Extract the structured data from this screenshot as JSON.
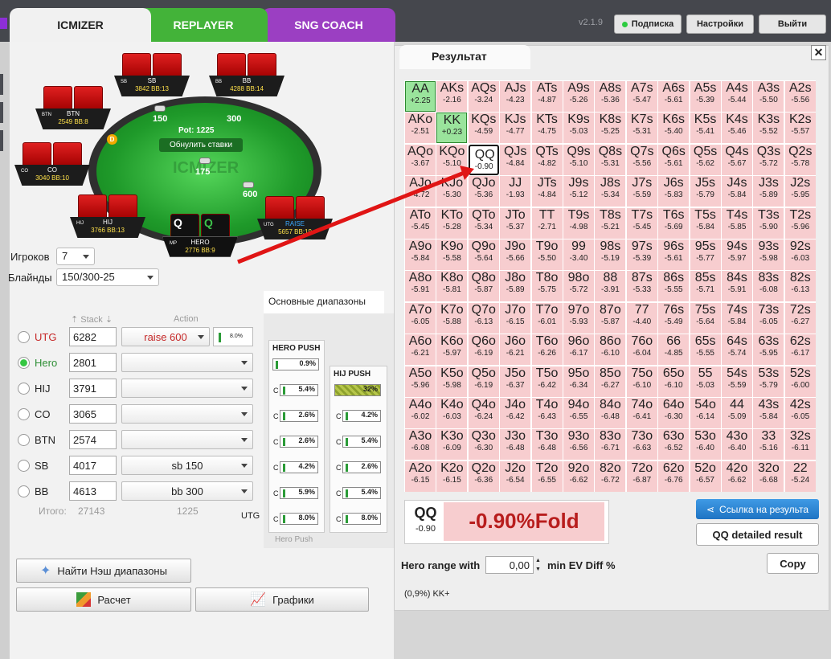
{
  "tabs": {
    "icmizer": "ICMIZER",
    "replayer": "REPLAYER",
    "sng_coach": "SNG COACH"
  },
  "version": "v2.1.9",
  "top_buttons": {
    "subscription": "Подписка",
    "settings": "Настройки",
    "exit": "Выйти"
  },
  "table": {
    "watermark": "ICMIZER",
    "pot": "Pot: 1225",
    "reset": "Обнулить ставки",
    "bets": {
      "sb": "150",
      "bb": "300",
      "hero": "175",
      "utg": "600"
    },
    "dealer": "D",
    "seats": [
      {
        "pos": "SB",
        "name": "SB",
        "info": "3842 BB:13"
      },
      {
        "pos": "BB",
        "name": "BB",
        "info": "4288 BB:14"
      },
      {
        "pos": "BTN",
        "name": "BTN",
        "info": "2549 BB:8"
      },
      {
        "pos": "CO",
        "name": "CO",
        "info": "3040 BB:10"
      },
      {
        "pos": "HIJ",
        "name": "HIJ",
        "info": "3766 BB:13"
      },
      {
        "pos": "UTG",
        "name": "RAISE",
        "info": "5657 BB:19"
      },
      {
        "pos": "MP",
        "name": "HERO",
        "info": "2776 BB:9"
      }
    ],
    "hero_cards": [
      "Q",
      "Q"
    ]
  },
  "settings": {
    "players_label": "Игроков",
    "players_value": "7",
    "blinds_label": "Блайнды",
    "blinds_value": "150/300-25"
  },
  "columns": {
    "stack": "Stack",
    "action": "Action"
  },
  "players": [
    {
      "name": "UTG",
      "stack": "6282",
      "action": "raise 600",
      "mini": "8.0%",
      "selected": false
    },
    {
      "name": "Hero",
      "stack": "2801",
      "action": "",
      "selected": true
    },
    {
      "name": "HIJ",
      "stack": "3791",
      "action": ""
    },
    {
      "name": "CO",
      "stack": "3065",
      "action": ""
    },
    {
      "name": "BTN",
      "stack": "2574",
      "action": ""
    },
    {
      "name": "SB",
      "stack": "4017",
      "action": "sb 150"
    },
    {
      "name": "BB",
      "stack": "4613",
      "action": "bb 300"
    }
  ],
  "totals": {
    "label": "Итого:",
    "stack": "27143",
    "pot": "1225",
    "utg": "UTG"
  },
  "ranges": {
    "tab": "Основные диапазоны",
    "hero_push": {
      "title": "HERO PUSH",
      "top": "0.9%",
      "values": [
        "5.4%",
        "2.6%",
        "2.6%",
        "4.2%",
        "5.9%",
        "8.0%"
      ],
      "footer": "Hero Push"
    },
    "hij_push": {
      "title": "HIJ PUSH",
      "top": "32%",
      "values": [
        "4.2%",
        "5.4%",
        "2.6%",
        "5.4%",
        "8.0%"
      ]
    },
    "c": "C"
  },
  "buttons": {
    "nash": "Найти Нэш диапазоны",
    "calc": "Расчет",
    "graphs": "Графики"
  },
  "result": {
    "title": "Результат",
    "close": "✕",
    "grid": [
      [
        [
          "AA",
          "+2.25"
        ],
        [
          "AKs",
          "-2.16"
        ],
        [
          "AQs",
          "-3.24"
        ],
        [
          "AJs",
          "-4.23"
        ],
        [
          "ATs",
          "-4.87"
        ],
        [
          "A9s",
          "-5.26"
        ],
        [
          "A8s",
          "-5.36"
        ],
        [
          "A7s",
          "-5.47"
        ],
        [
          "A6s",
          "-5.61"
        ],
        [
          "A5s",
          "-5.39"
        ],
        [
          "A4s",
          "-5.44"
        ],
        [
          "A3s",
          "-5.50"
        ],
        [
          "A2s",
          "-5.56"
        ]
      ],
      [
        [
          "AKo",
          "-2.51"
        ],
        [
          "KK",
          "+0.23"
        ],
        [
          "KQs",
          "-4.59"
        ],
        [
          "KJs",
          "-4.77"
        ],
        [
          "KTs",
          "-4.75"
        ],
        [
          "K9s",
          "-5.03"
        ],
        [
          "K8s",
          "-5.25"
        ],
        [
          "K7s",
          "-5.31"
        ],
        [
          "K6s",
          "-5.40"
        ],
        [
          "K5s",
          "-5.41"
        ],
        [
          "K4s",
          "-5.46"
        ],
        [
          "K3s",
          "-5.52"
        ],
        [
          "K2s",
          "-5.57"
        ]
      ],
      [
        [
          "AQo",
          "-3.67"
        ],
        [
          "KQo",
          "-5.10"
        ],
        [
          "QQ",
          "-0.90"
        ],
        [
          "QJs",
          "-4.84"
        ],
        [
          "QTs",
          "-4.82"
        ],
        [
          "Q9s",
          "-5.10"
        ],
        [
          "Q8s",
          "-5.31"
        ],
        [
          "Q7s",
          "-5.56"
        ],
        [
          "Q6s",
          "-5.61"
        ],
        [
          "Q5s",
          "-5.62"
        ],
        [
          "Q4s",
          "-5.67"
        ],
        [
          "Q3s",
          "-5.72"
        ],
        [
          "Q2s",
          "-5.78"
        ]
      ],
      [
        [
          "AJo",
          "-4.72"
        ],
        [
          "KJo",
          "-5.30"
        ],
        [
          "QJo",
          "-5.36"
        ],
        [
          "JJ",
          "-1.93"
        ],
        [
          "JTs",
          "-4.84"
        ],
        [
          "J9s",
          "-5.12"
        ],
        [
          "J8s",
          "-5.34"
        ],
        [
          "J7s",
          "-5.59"
        ],
        [
          "J6s",
          "-5.83"
        ],
        [
          "J5s",
          "-5.79"
        ],
        [
          "J4s",
          "-5.84"
        ],
        [
          "J3s",
          "-5.89"
        ],
        [
          "J2s",
          "-5.95"
        ]
      ],
      [
        [
          "ATo",
          "-5.45"
        ],
        [
          "KTo",
          "-5.28"
        ],
        [
          "QTo",
          "-5.34"
        ],
        [
          "JTo",
          "-5.37"
        ],
        [
          "TT",
          "-2.71"
        ],
        [
          "T9s",
          "-4.98"
        ],
        [
          "T8s",
          "-5.21"
        ],
        [
          "T7s",
          "-5.45"
        ],
        [
          "T6s",
          "-5.69"
        ],
        [
          "T5s",
          "-5.84"
        ],
        [
          "T4s",
          "-5.85"
        ],
        [
          "T3s",
          "-5.90"
        ],
        [
          "T2s",
          "-5.96"
        ]
      ],
      [
        [
          "A9o",
          "-5.84"
        ],
        [
          "K9o",
          "-5.58"
        ],
        [
          "Q9o",
          "-5.64"
        ],
        [
          "J9o",
          "-5.66"
        ],
        [
          "T9o",
          "-5.50"
        ],
        [
          "99",
          "-3.40"
        ],
        [
          "98s",
          "-5.19"
        ],
        [
          "97s",
          "-5.39"
        ],
        [
          "96s",
          "-5.61"
        ],
        [
          "95s",
          "-5.77"
        ],
        [
          "94s",
          "-5.97"
        ],
        [
          "93s",
          "-5.98"
        ],
        [
          "92s",
          "-6.03"
        ]
      ],
      [
        [
          "A8o",
          "-5.91"
        ],
        [
          "K8o",
          "-5.81"
        ],
        [
          "Q8o",
          "-5.87"
        ],
        [
          "J8o",
          "-5.89"
        ],
        [
          "T8o",
          "-5.75"
        ],
        [
          "98o",
          "-5.72"
        ],
        [
          "88",
          "-3.91"
        ],
        [
          "87s",
          "-5.33"
        ],
        [
          "86s",
          "-5.55"
        ],
        [
          "85s",
          "-5.71"
        ],
        [
          "84s",
          "-5.91"
        ],
        [
          "83s",
          "-6.08"
        ],
        [
          "82s",
          "-6.13"
        ]
      ],
      [
        [
          "A7o",
          "-6.05"
        ],
        [
          "K7o",
          "-5.88"
        ],
        [
          "Q7o",
          "-6.13"
        ],
        [
          "J7o",
          "-6.15"
        ],
        [
          "T7o",
          "-6.01"
        ],
        [
          "97o",
          "-5.93"
        ],
        [
          "87o",
          "-5.87"
        ],
        [
          "77",
          "-4.40"
        ],
        [
          "76s",
          "-5.49"
        ],
        [
          "75s",
          "-5.64"
        ],
        [
          "74s",
          "-5.84"
        ],
        [
          "73s",
          "-6.05"
        ],
        [
          "72s",
          "-6.27"
        ]
      ],
      [
        [
          "A6o",
          "-6.21"
        ],
        [
          "K6o",
          "-5.97"
        ],
        [
          "Q6o",
          "-6.19"
        ],
        [
          "J6o",
          "-6.21"
        ],
        [
          "T6o",
          "-6.26"
        ],
        [
          "96o",
          "-6.17"
        ],
        [
          "86o",
          "-6.10"
        ],
        [
          "76o",
          "-6.04"
        ],
        [
          "66",
          "-4.85"
        ],
        [
          "65s",
          "-5.55"
        ],
        [
          "64s",
          "-5.74"
        ],
        [
          "63s",
          "-5.95"
        ],
        [
          "62s",
          "-6.17"
        ]
      ],
      [
        [
          "A5o",
          "-5.96"
        ],
        [
          "K5o",
          "-5.98"
        ],
        [
          "Q5o",
          "-6.19"
        ],
        [
          "J5o",
          "-6.37"
        ],
        [
          "T5o",
          "-6.42"
        ],
        [
          "95o",
          "-6.34"
        ],
        [
          "85o",
          "-6.27"
        ],
        [
          "75o",
          "-6.10"
        ],
        [
          "65o",
          "-6.10"
        ],
        [
          "55",
          "-5.03"
        ],
        [
          "54s",
          "-5.59"
        ],
        [
          "53s",
          "-5.79"
        ],
        [
          "52s",
          "-6.00"
        ]
      ],
      [
        [
          "A4o",
          "-6.02"
        ],
        [
          "K4o",
          "-6.03"
        ],
        [
          "Q4o",
          "-6.24"
        ],
        [
          "J4o",
          "-6.42"
        ],
        [
          "T4o",
          "-6.43"
        ],
        [
          "94o",
          "-6.55"
        ],
        [
          "84o",
          "-6.48"
        ],
        [
          "74o",
          "-6.41"
        ],
        [
          "64o",
          "-6.30"
        ],
        [
          "54o",
          "-6.14"
        ],
        [
          "44",
          "-5.09"
        ],
        [
          "43s",
          "-5.84"
        ],
        [
          "42s",
          "-6.05"
        ]
      ],
      [
        [
          "A3o",
          "-6.08"
        ],
        [
          "K3o",
          "-6.09"
        ],
        [
          "Q3o",
          "-6.30"
        ],
        [
          "J3o",
          "-6.48"
        ],
        [
          "T3o",
          "-6.48"
        ],
        [
          "93o",
          "-6.56"
        ],
        [
          "83o",
          "-6.71"
        ],
        [
          "73o",
          "-6.63"
        ],
        [
          "63o",
          "-6.52"
        ],
        [
          "53o",
          "-6.40"
        ],
        [
          "43o",
          "-6.40"
        ],
        [
          "33",
          "-5.16"
        ],
        [
          "32s",
          "-6.11"
        ]
      ],
      [
        [
          "A2o",
          "-6.15"
        ],
        [
          "K2o",
          "-6.15"
        ],
        [
          "Q2o",
          "-6.36"
        ],
        [
          "J2o",
          "-6.54"
        ],
        [
          "T2o",
          "-6.55"
        ],
        [
          "92o",
          "-6.62"
        ],
        [
          "82o",
          "-6.72"
        ],
        [
          "72o",
          "-6.87"
        ],
        [
          "62o",
          "-6.76"
        ],
        [
          "52o",
          "-6.57"
        ],
        [
          "42o",
          "-6.62"
        ],
        [
          "32o",
          "-6.68"
        ],
        [
          "22",
          "-5.24"
        ]
      ]
    ],
    "selected_hand": "QQ",
    "selected_ev": "-0.90",
    "selected_result": "-0.90%Fold",
    "share": "Ссылка на результа",
    "detail": "QQ detailed result",
    "copy": "Copy",
    "hero_range_label": "Hero range with",
    "hero_range_value": "0,00",
    "min_ev": "min EV Diff %",
    "footer": "(0,9%) KK+"
  }
}
